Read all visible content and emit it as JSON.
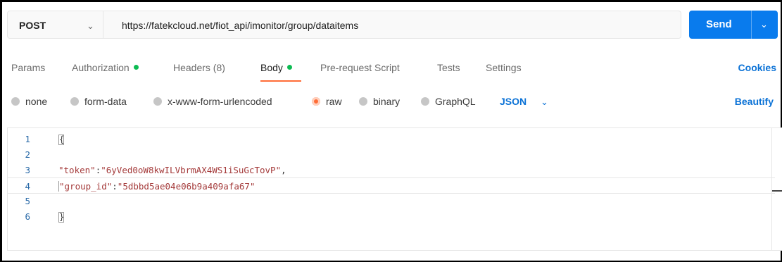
{
  "request": {
    "method": "POST",
    "url": "https://fatekcloud.net/fiot_api/imonitor/group/dataitems",
    "send_label": "Send"
  },
  "tabs": [
    {
      "label": "Params",
      "active": false,
      "dot": false
    },
    {
      "label": "Authorization",
      "active": false,
      "dot": true
    },
    {
      "label": "Headers (8)",
      "active": false,
      "dot": false
    },
    {
      "label": "Body",
      "active": true,
      "dot": true
    },
    {
      "label": "Pre-request Script",
      "active": false,
      "dot": false
    },
    {
      "label": "Tests",
      "active": false,
      "dot": false
    },
    {
      "label": "Settings",
      "active": false,
      "dot": false
    }
  ],
  "cookies_label": "Cookies",
  "body_types": [
    {
      "label": "none",
      "selected": false
    },
    {
      "label": "form-data",
      "selected": false
    },
    {
      "label": "x-www-form-urlencoded",
      "selected": false
    },
    {
      "label": "raw",
      "selected": true
    },
    {
      "label": "binary",
      "selected": false
    },
    {
      "label": "GraphQL",
      "selected": false
    }
  ],
  "raw_format": "JSON",
  "beautify_label": "Beautify",
  "editor": {
    "lines": [
      {
        "num": "1",
        "open": "{"
      },
      {
        "num": "2"
      },
      {
        "num": "3",
        "key": "\"token\"",
        "sep": ":",
        "value": "\"6yVed0oW8kwILVbrmAX4WS1iSuGcTovP\"",
        "tail": ","
      },
      {
        "num": "4",
        "key": "\"group_id\"",
        "sep": ":",
        "value": "\"5dbbd5ae04e06b9a409afa67\"",
        "tail": ""
      },
      {
        "num": "5"
      },
      {
        "num": "6",
        "close": "}"
      }
    ]
  },
  "colors": {
    "send": "#097bed",
    "accent": "#ff6c37",
    "link": "#0b72d6",
    "status_dot": "#0cbb52"
  }
}
